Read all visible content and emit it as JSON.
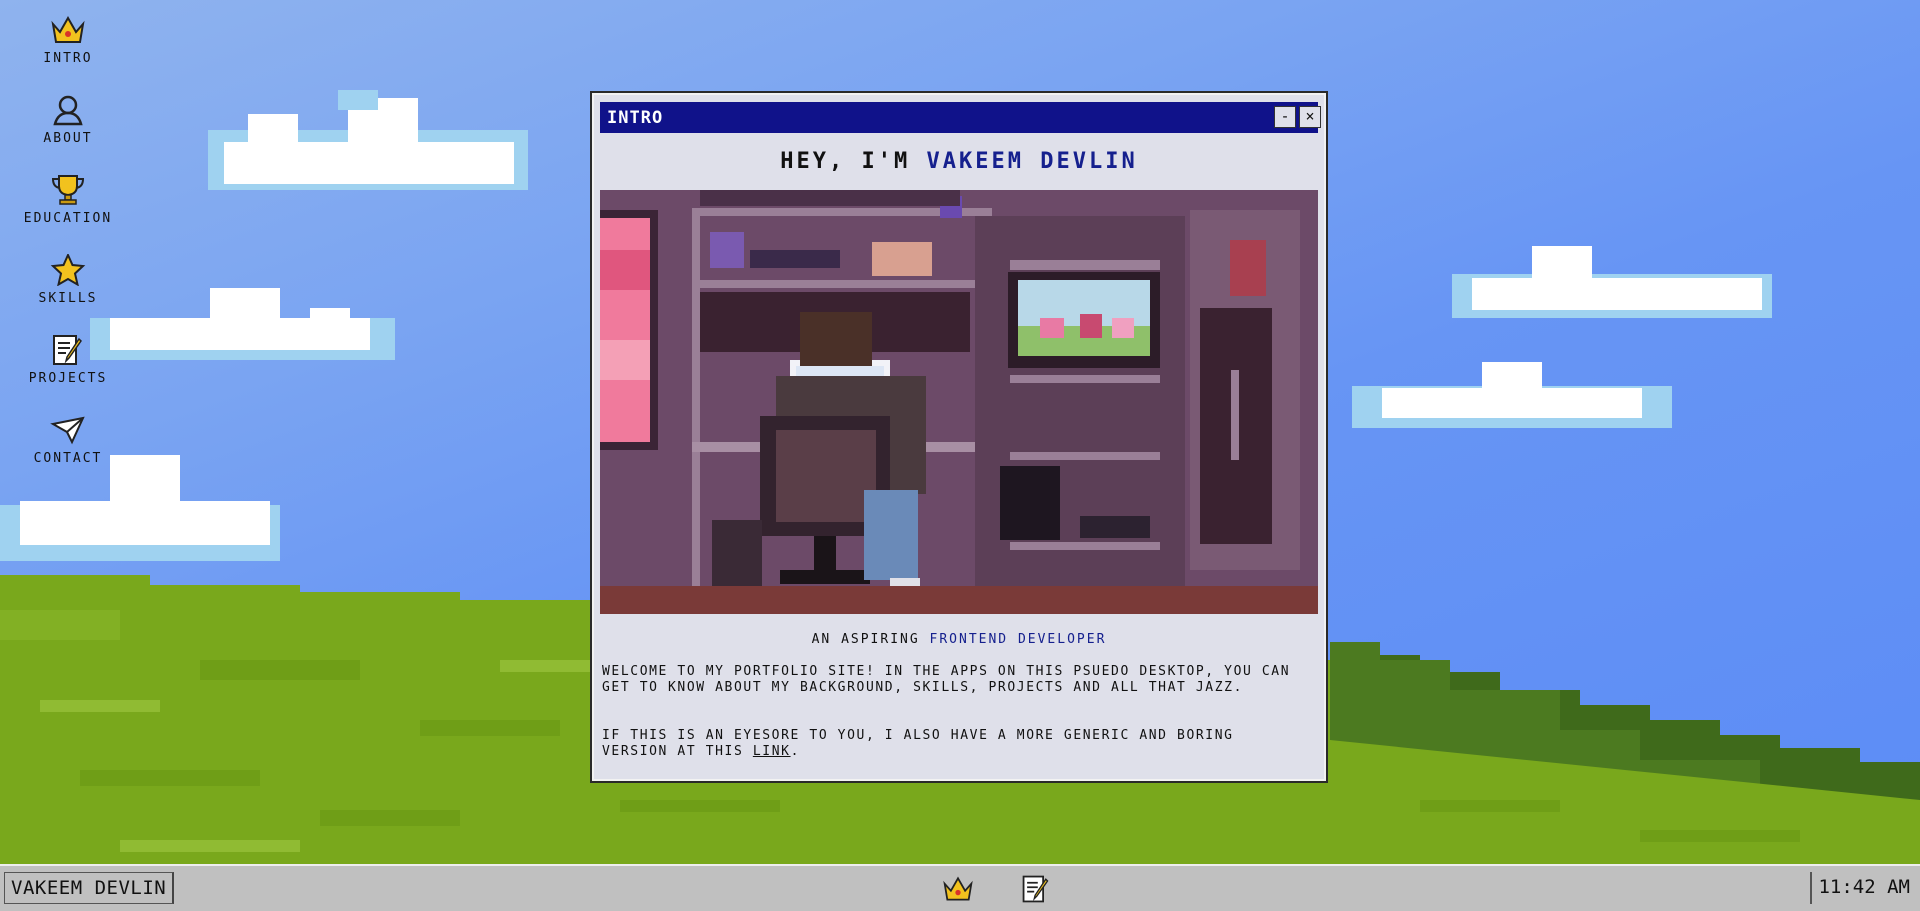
{
  "desktop": {
    "icons": [
      {
        "label": "INTRO",
        "icon": "crown-icon"
      },
      {
        "label": "ABOUT",
        "icon": "user-icon"
      },
      {
        "label": "EDUCATION",
        "icon": "trophy-icon"
      },
      {
        "label": "SKILLS",
        "icon": "star-icon"
      },
      {
        "label": "PROJECTS",
        "icon": "notepad-icon"
      },
      {
        "label": "CONTACT",
        "icon": "paper-plane-icon"
      }
    ]
  },
  "window": {
    "title": "INTRO",
    "minimize_label": "-",
    "close_label": "×",
    "heading_prefix": "HEY, I'M",
    "heading_name": "VAKEEM DEVLIN",
    "image_alt": "pixel art of a person at a desk with a computer and TV",
    "subtitle_prefix": "AN ASPIRING",
    "subtitle_highlight": "FRONTEND DEVELOPER",
    "paragraph1": "WELCOME TO MY PORTFOLIO SITE! IN THE APPS ON THIS PSUEDO DESKTOP, YOU CAN GET TO KNOW ABOUT MY BACKGROUND, SKILLS, PROJECTS AND ALL THAT JAZZ.",
    "paragraph2_prefix": "IF THIS IS AN EYESORE TO YOU, I ALSO HAVE A MORE GENERIC AND BORING VERSION AT THIS",
    "paragraph2_link": "LINK",
    "paragraph2_suffix": "."
  },
  "taskbar": {
    "start_label": "VAKEEM DEVLIN",
    "apps": [
      "crown-icon",
      "notepad-icon"
    ],
    "clock": "11:42 AM"
  },
  "colors": {
    "titlebar": "#10128a",
    "accent_text": "#15208e",
    "window_bg": "#dfe0ea",
    "taskbar_bg": "#c0c0c0"
  }
}
